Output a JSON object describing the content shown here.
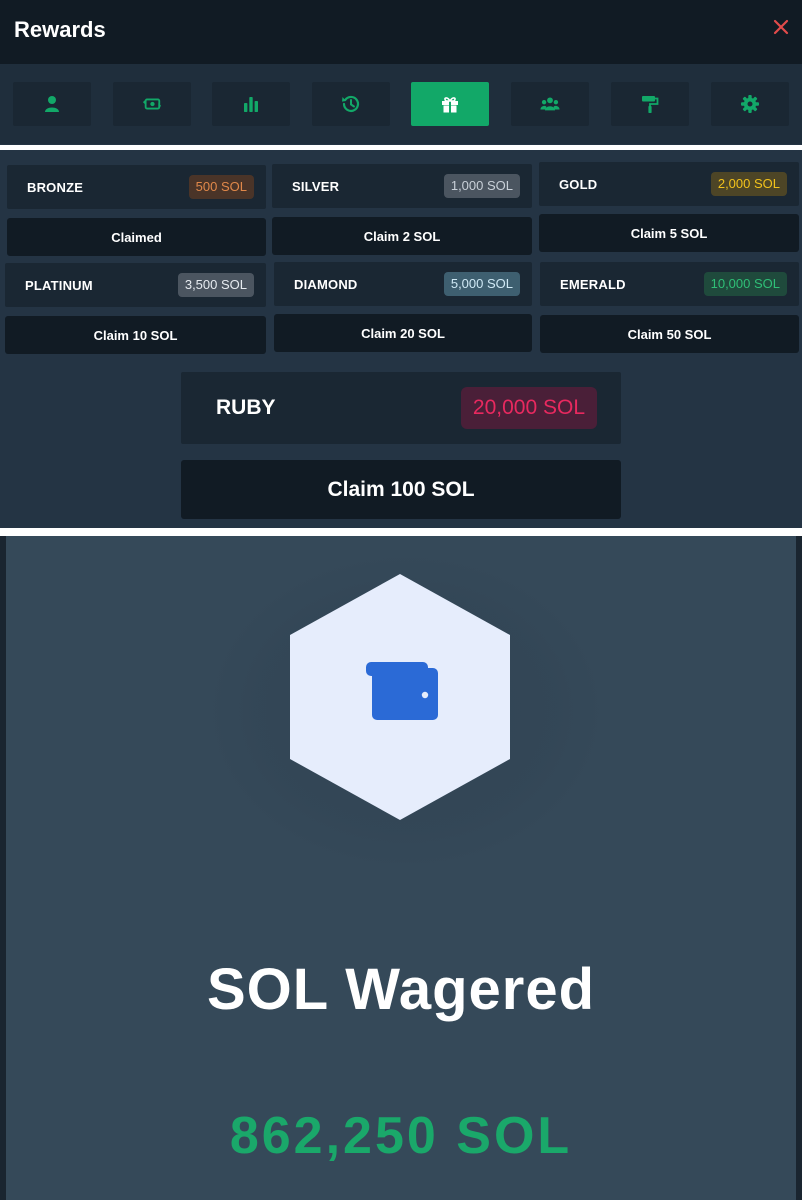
{
  "modal": {
    "title": "Rewards"
  },
  "tabs": [
    {
      "icon": "user-icon"
    },
    {
      "icon": "money-exchange-icon"
    },
    {
      "icon": "bar-chart-icon"
    },
    {
      "icon": "history-icon"
    },
    {
      "icon": "gift-icon",
      "active": true
    },
    {
      "icon": "users-icon"
    },
    {
      "icon": "paint-roller-icon"
    },
    {
      "icon": "gear-icon"
    }
  ],
  "tiers": [
    {
      "name": "BRONZE",
      "threshold": "500 SOL",
      "claim_label": "Claimed",
      "badge_bg": "#4a3428",
      "badge_color": "#e0884a"
    },
    {
      "name": "SILVER",
      "threshold": "1,000 SOL",
      "claim_label": "Claim 2 SOL",
      "badge_bg": "#4b5560",
      "badge_color": "#c9d0d8"
    },
    {
      "name": "GOLD",
      "threshold": "2,000 SOL",
      "claim_label": "Claim 5 SOL",
      "badge_bg": "#4d4526",
      "badge_color": "#f2c21b"
    },
    {
      "name": "PLATINUM",
      "threshold": "3,500 SOL",
      "claim_label": "Claim 10 SOL",
      "badge_bg": "#4b5560",
      "badge_color": "#e6ebf0"
    },
    {
      "name": "DIAMOND",
      "threshold": "5,000 SOL",
      "claim_label": "Claim 20 SOL",
      "badge_bg": "#3e5f70",
      "badge_color": "#cfe9f5"
    },
    {
      "name": "EMERALD",
      "threshold": "10,000 SOL",
      "claim_label": "Claim 50 SOL",
      "badge_bg": "#1f4a3c",
      "badge_color": "#2fbf77"
    }
  ],
  "ruby": {
    "name": "RUBY",
    "threshold": "20,000 SOL",
    "claim_label": "Claim 100 SOL"
  },
  "wager": {
    "title": "SOL Wagered",
    "value": "862,250 SOL",
    "icon": "wallet-icon"
  },
  "colors": {
    "accent": "#12a868",
    "close": "#e24b4b",
    "ruby": "#e8295f",
    "value_green": "#1aa86a"
  }
}
